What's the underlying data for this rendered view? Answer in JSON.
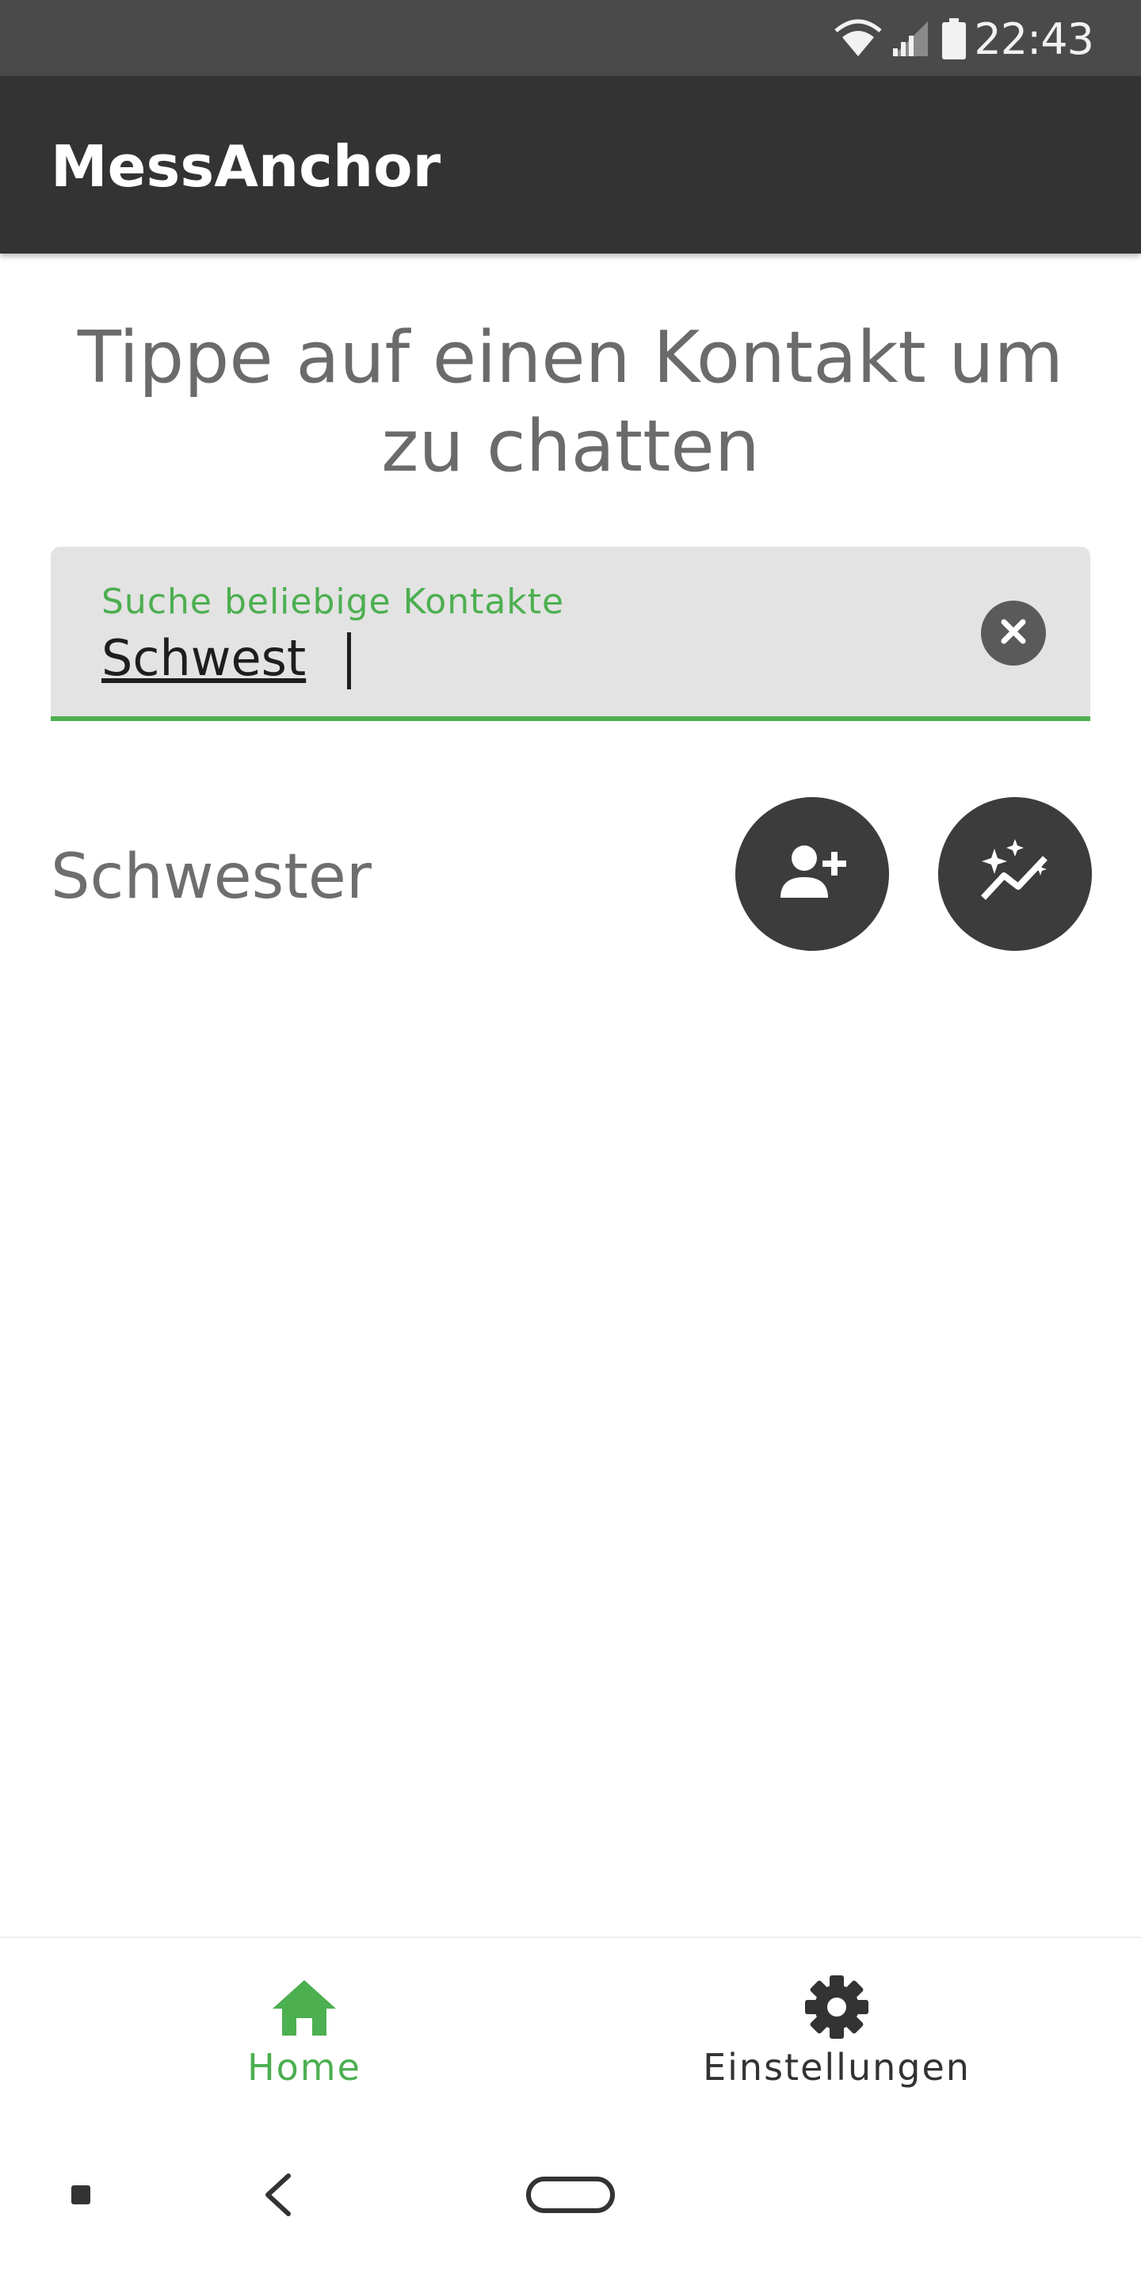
{
  "status_bar": {
    "time": "22:43",
    "icons": [
      "wifi-icon",
      "signal-icon",
      "battery-icon"
    ]
  },
  "app_bar": {
    "title": "MessAnchor"
  },
  "main": {
    "heading": "Tippe auf einen Kontakt um zu chatten",
    "search": {
      "label": "Suche beliebige Kontakte",
      "value": "Schwest",
      "clear_icon": "clear-icon"
    },
    "results": [
      {
        "name": "Schwester",
        "actions": [
          "add-contact-icon",
          "auto-awesome-trend-icon"
        ]
      }
    ]
  },
  "bottom_nav": {
    "items": [
      {
        "label": "Home",
        "icon": "home-icon",
        "active": true
      },
      {
        "label": "Einstellungen",
        "icon": "gear-icon",
        "active": false
      }
    ]
  },
  "system_nav": {
    "buttons": [
      "recents-button",
      "back-button",
      "home-pill-button"
    ]
  },
  "colors": {
    "status_bar": "#4a4a4a",
    "app_bar": "#333333",
    "accent": "#4caf50",
    "button_dark": "#3c3c3c",
    "field_bg": "#e3e3e3",
    "text_muted": "#6e6e6e",
    "nav_inactive": "#333333"
  }
}
